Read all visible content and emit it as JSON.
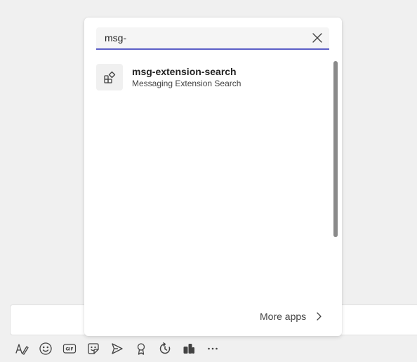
{
  "search": {
    "value": "msg-",
    "clear_icon": "close-icon"
  },
  "results": [
    {
      "title": "msg-extension-search",
      "subtitle": "Messaging Extension Search",
      "icon": "app-icon"
    }
  ],
  "footer": {
    "more_apps_label": "More apps",
    "chevron_icon": "chevron-right-icon"
  },
  "toolbar": {
    "items": [
      "format-icon",
      "emoji-icon",
      "gif-icon",
      "sticker-icon",
      "schedule-meeting-icon",
      "praise-icon",
      "loop-icon",
      "viva-icon",
      "more-options-icon"
    ]
  },
  "colors": {
    "accent": "#5b5fc7",
    "background": "#f0f0f0",
    "panel": "#ffffff"
  }
}
